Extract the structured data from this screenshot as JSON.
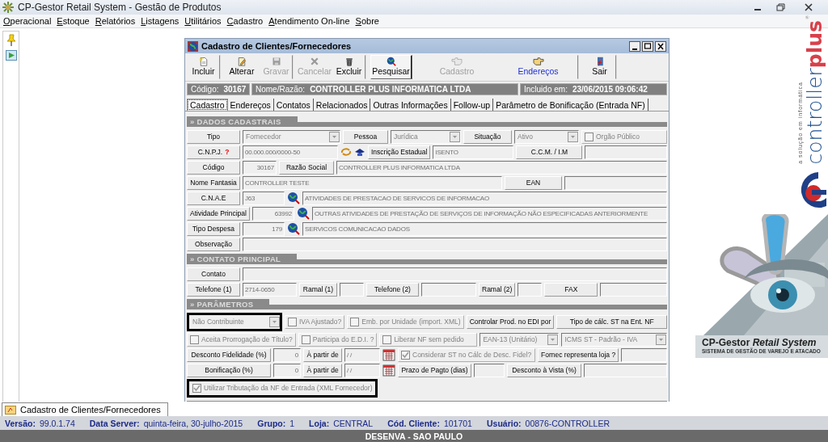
{
  "app": {
    "title": "CP-Gestor Retail System - Gestão de Produtos"
  },
  "menu": [
    "Operacional",
    "Estoque",
    "Relatórios",
    "Listagens",
    "Utilitários",
    "Cadastro",
    "Atendimento On-line",
    "Sobre"
  ],
  "dialog": {
    "title": "Cadastro de Clientes/Fornecedores",
    "toolbar": [
      {
        "kind": "new",
        "label": "Incluir",
        "disabled": false,
        "pressed": false,
        "highlighted": false,
        "separator_after": true
      },
      {
        "kind": "edit",
        "label": "Alterar",
        "disabled": false,
        "pressed": false,
        "highlighted": false,
        "separator_after": false
      },
      {
        "kind": "save",
        "label": "Gravar",
        "disabled": true,
        "pressed": false,
        "highlighted": false,
        "separator_after": true
      },
      {
        "kind": "cancel",
        "label": "Cancelar",
        "disabled": true,
        "pressed": false,
        "highlighted": false,
        "separator_after": false
      },
      {
        "kind": "delete",
        "label": "Excluir",
        "disabled": false,
        "pressed": false,
        "highlighted": false,
        "separator_after": true
      },
      {
        "kind": "search",
        "label": "Pesquisar",
        "disabled": false,
        "pressed": true,
        "highlighted": false,
        "separator_after": true
      },
      {
        "kind": "back",
        "label": "Cadastro",
        "disabled": true,
        "pressed": false,
        "highlighted": false,
        "separator_after": false
      },
      {
        "kind": "forward",
        "label": "Endereços",
        "disabled": false,
        "pressed": false,
        "highlighted": true,
        "separator_after": true
      },
      {
        "kind": "exit",
        "label": "Sair",
        "disabled": false,
        "pressed": false,
        "highlighted": false,
        "separator_after": true
      }
    ],
    "header": {
      "code_label": "Código:",
      "code": "30167",
      "name_label": "Nome/Razão:",
      "name": "CONTROLLER PLUS INFORMATICA LTDA",
      "included_label": "Incluido em:",
      "included": "23/06/2015 09:06:42"
    },
    "tabs": [
      {
        "label": "Cadastro",
        "selected": true
      },
      {
        "label": "Endereços",
        "selected": false
      },
      {
        "label": "Contatos",
        "selected": false
      },
      {
        "label": "Relacionados",
        "selected": false
      },
      {
        "label": "Outras Informações",
        "selected": false
      },
      {
        "label": "Follow-up",
        "selected": false
      },
      {
        "label": "Parâmetro de Bonificação (Entrada NF)",
        "selected": false
      }
    ],
    "sections": [
      {
        "title": "» DADOS CADASTRAIS",
        "lines": [
          {
            "items": [
              {
                "kind": "label",
                "label": "Tipo"
              },
              {
                "kind": "combo",
                "value": "Fornecedor",
                "disabled": true,
                "highlighted": false
              },
              {
                "kind": "label",
                "label": "Pessoa"
              },
              {
                "kind": "combo",
                "value": "Jurídica",
                "disabled": true,
                "highlighted": false
              },
              {
                "kind": "label",
                "label": "Situação"
              },
              {
                "kind": "combo",
                "value": "Ativo",
                "disabled": true,
                "highlighted": false
              },
              {
                "kind": "check",
                "label": "Orgão Público",
                "checked": false,
                "disabled": true,
                "highlighted": false
              }
            ]
          },
          {
            "items": [
              {
                "kind": "label",
                "label": "C.N.P.J.",
                "hint": "?"
              },
              {
                "kind": "field",
                "value": "00.000.000/0000-50"
              },
              {
                "kind": "refresh_button"
              },
              {
                "kind": "web_button"
              },
              {
                "kind": "label",
                "label": "Inscrição Estadual"
              },
              {
                "kind": "field",
                "value": "ISENTO"
              },
              {
                "kind": "label",
                "label": "C.C.M. / I.M"
              },
              {
                "kind": "field"
              }
            ]
          },
          {
            "items": [
              {
                "kind": "label",
                "label": "Código"
              },
              {
                "kind": "number_field",
                "value": "30167"
              },
              {
                "kind": "label",
                "label": "Razão Social"
              },
              {
                "kind": "field",
                "value": "CONTROLLER PLUS INFORMATICA LTDA"
              }
            ]
          },
          {
            "items": [
              {
                "kind": "label",
                "label": "Nome Fantasia"
              },
              {
                "kind": "field",
                "value": "CONTROLLER TESTE"
              },
              {
                "kind": "label",
                "label": "EAN"
              },
              {
                "kind": "field"
              }
            ]
          },
          {
            "items": [
              {
                "kind": "label",
                "label": "C.N.A.E"
              },
              {
                "kind": "field",
                "value": "J63"
              },
              {
                "kind": "lookup_button"
              },
              {
                "kind": "field",
                "value": "ATIVIDADES DE PRESTACAO DE SERVICOS DE INFORMACAO"
              }
            ]
          },
          {
            "items": [
              {
                "kind": "label",
                "label": "Atividade Principal"
              },
              {
                "kind": "number_field",
                "value": "63992"
              },
              {
                "kind": "lookup_button"
              },
              {
                "kind": "field",
                "value": "OUTRAS ATIVIDADES DE PRESTAÇÃO DE SERVIÇOS DE INFORMAÇÃO NÃO ESPECIFICADAS ANTERIORMENTE"
              }
            ]
          },
          {
            "items": [
              {
                "kind": "label",
                "label": "Tipo Despesa"
              },
              {
                "kind": "number_field",
                "value": "179"
              },
              {
                "kind": "lookup_button"
              },
              {
                "kind": "field",
                "value": "SERVICOS COMUNICACAO DADOS"
              }
            ]
          },
          {
            "items": [
              {
                "kind": "label",
                "label": "Observação"
              },
              {
                "kind": "field"
              }
            ]
          }
        ]
      },
      {
        "title": "» CONTATO PRINCIPAL",
        "lines": [
          {
            "items": [
              {
                "kind": "label",
                "label": "Contato"
              },
              {
                "kind": "field"
              }
            ]
          },
          {
            "items": [
              {
                "kind": "label",
                "label": "Telefone (1)"
              },
              {
                "kind": "field",
                "value": "2714-0650"
              },
              {
                "kind": "label",
                "label": "Ramal (1)"
              },
              {
                "kind": "field"
              },
              {
                "kind": "label",
                "label": "Telefone (2)"
              },
              {
                "kind": "field"
              },
              {
                "kind": "label",
                "label": "Ramal (2)"
              },
              {
                "kind": "field"
              },
              {
                "kind": "label",
                "label": "FAX"
              },
              {
                "kind": "field"
              }
            ]
          }
        ]
      },
      {
        "title": "» PARÂMETROS",
        "lines": [
          {
            "items": [
              {
                "kind": "combo",
                "value": "Não Contribuinte",
                "disabled": true,
                "highlighted": true
              },
              {
                "kind": "check",
                "label": "IVA Ajustado?",
                "checked": false,
                "disabled": true,
                "highlighted": false
              },
              {
                "kind": "check",
                "label": "Emb. por Unidade (import. XML)",
                "checked": false,
                "disabled": true,
                "highlighted": false
              },
              {
                "kind": "label",
                "label": "Controlar Prod. no EDI por"
              },
              {
                "kind": "label",
                "label": "Tipo de cálc. ST na Ent. NF"
              }
            ]
          },
          {
            "items": [
              {
                "kind": "check",
                "label": "Aceita Prorrogação de Título?",
                "checked": false,
                "disabled": true,
                "highlighted": false
              },
              {
                "kind": "check",
                "label": "Participa do E.D.I. ?",
                "checked": false,
                "disabled": true,
                "highlighted": false
              },
              {
                "kind": "check",
                "label": "Liberar NF sem pedido",
                "checked": false,
                "disabled": true,
                "highlighted": false
              },
              {
                "kind": "combo",
                "value": "EAN-13 (Unitário)",
                "disabled": true,
                "highlighted": false
              },
              {
                "kind": "combo",
                "value": "ICMS ST - Padrão - IVA",
                "disabled": true,
                "highlighted": false
              }
            ]
          },
          {
            "items": [
              {
                "kind": "label",
                "label": "Desconto Fidelidade (%)"
              },
              {
                "kind": "number_field",
                "value": "0"
              },
              {
                "kind": "label",
                "label": "À partir de"
              },
              {
                "kind": "field",
                "value": "/ /"
              },
              {
                "kind": "date_button"
              },
              {
                "kind": "check",
                "label": "Considerar ST no Cálc de Desc. Fidel?",
                "checked": true,
                "disabled": true,
                "highlighted": false
              },
              {
                "kind": "label",
                "label": "Fornec representa loja ?"
              },
              {
                "kind": "field"
              }
            ]
          },
          {
            "items": [
              {
                "kind": "label",
                "label": "Bonificação (%)"
              },
              {
                "kind": "number_field",
                "value": "0"
              },
              {
                "kind": "label",
                "label": "À partir de"
              },
              {
                "kind": "field",
                "value": "/ /"
              },
              {
                "kind": "date_button"
              },
              {
                "kind": "label",
                "label": "Prazo de Pagto (dias)"
              },
              {
                "kind": "field"
              },
              {
                "kind": "label",
                "label": "Desconto à Vista (%)"
              },
              {
                "kind": "field"
              }
            ]
          },
          {
            "items": [
              {
                "kind": "check",
                "label": "Utilizar Tributação da NF de Entrada (XML Fornecedor)",
                "checked": true,
                "disabled": true,
                "highlighted": true
              }
            ]
          }
        ]
      }
    ]
  },
  "brand": {
    "wordmark": "controller**plus**$^{®}$",
    "tagline": "a solução em informática",
    "title": "CP-Gestor *Retail System*",
    "subtitle": "SISTEMA DE GESTÃO DE VAREJO E ATACADO"
  },
  "taskbar": [
    {
      "label": "Cadastro de Clientes/Fornecedores",
      "selected": true
    }
  ],
  "status": [
    {
      "label": "Versão:",
      "value": "99.0.1.74"
    },
    {
      "label": "Data Server:",
      "value": "quinta-feira, 30-julho-2015"
    },
    {
      "label": "Grupo:",
      "value": "1"
    },
    {
      "label": "Loja:",
      "value": "CENTRAL"
    },
    {
      "label": "Cód. Cliente:",
      "value": "101701"
    },
    {
      "label": "Usuário:",
      "value": "00876-CONTROLLER"
    }
  ],
  "footer": "DESENVA - SAO PAULO"
}
